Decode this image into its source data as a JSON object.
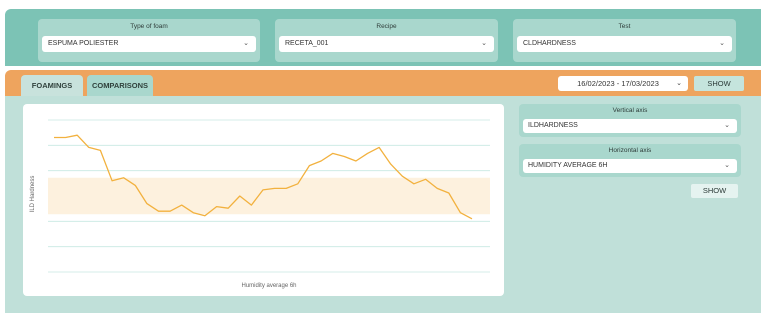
{
  "filters": {
    "foam": {
      "label": "Type of foam",
      "value": "ESPUMA POLIESTER"
    },
    "recipe": {
      "label": "Recipe",
      "value": "RECETA_001"
    },
    "test": {
      "label": "Test",
      "value": "CLDHARDNESS"
    }
  },
  "tabs": {
    "active": "FOAMINGS",
    "inactive": "COMPARISONS"
  },
  "date_range": "16/02/2023 - 17/03/2023",
  "show_label": "SHOW",
  "axes": {
    "vertical": {
      "label": "Vertical axis",
      "value": "ILDHARDNESS"
    },
    "horizontal": {
      "label": "Horizontal axis",
      "value": "HUMIDITY AVERAGE 6H"
    },
    "show_label": "SHOW"
  },
  "icons": {
    "chevron": "chevron-down-icon"
  },
  "colors": {
    "line": "#f2b13e",
    "band": "#fdf1de",
    "grid": "#c7e8e2",
    "accent": "#eea45e",
    "teal": "#7cc3b5"
  },
  "chart_data": {
    "type": "line",
    "title": "",
    "xlabel": "Humidity average 6h",
    "ylabel": "ILD Hardness",
    "band": [
      0.38,
      0.62
    ],
    "series": [
      {
        "values": [
          0.885,
          0.885,
          0.9,
          0.82,
          0.8,
          0.6,
          0.62,
          0.57,
          0.45,
          0.4,
          0.4,
          0.44,
          0.39,
          0.37,
          0.43,
          0.42,
          0.5,
          0.44,
          0.54,
          0.55,
          0.55,
          0.58,
          0.7,
          0.73,
          0.78,
          0.76,
          0.73,
          0.78,
          0.82,
          0.71,
          0.63,
          0.58,
          0.61,
          0.55,
          0.52,
          0.39,
          0.35
        ]
      }
    ]
  }
}
